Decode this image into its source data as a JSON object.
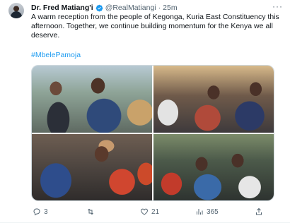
{
  "tweet": {
    "author_name": "Dr. Fred Matiang'i",
    "handle": "@RealMatiangi",
    "separator": "·",
    "time": "25m",
    "more_label": "···",
    "text": "A warm reception from the people of Kegonga, Kuria East Constituency this afternoon. Together, we continue building momentum for the Kenya we all deserve.",
    "hashtag": "#MbelePamoja",
    "media_count": 4
  },
  "actions": {
    "reply_count": "3",
    "retweet_count": "",
    "like_count": "21",
    "views_count": "365",
    "share_count": ""
  },
  "colors": {
    "verified": "#1d9bf0",
    "link": "#1d9bf0",
    "secondary_text": "#536471"
  },
  "icons": {
    "verified": "verified-badge-icon",
    "reply": "reply-icon",
    "retweet": "retweet-icon",
    "like": "heart-icon",
    "views": "views-icon",
    "share": "share-icon"
  }
}
